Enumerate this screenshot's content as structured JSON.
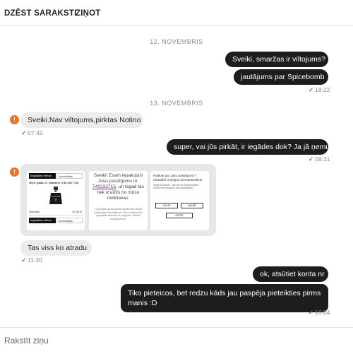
{
  "header": {
    "delete_label": "DZĒST SARAKSTI",
    "report_label": "ZIŅOT"
  },
  "dates": {
    "first": "12. NOVEMBRIS",
    "second": "13. NOVEMBRIS"
  },
  "messages": [
    {
      "text": "Sveiki, smaržas ir viltojums?"
    },
    {
      "text": "jautājums par Spicebomb",
      "time": "18:22"
    },
    {
      "text": "Sveiki.Nav viltojums,pirktas Notino",
      "time": "07:42"
    },
    {
      "text": "super, vai jūs pirkāt, ir iegādes dok? Ja jā ņemu",
      "time": "09:31"
    },
    {
      "text": "Tas viss ko atradu",
      "time": "11:30"
    },
    {
      "text": "ok, atsūtiet konta nr"
    },
    {
      "text": "Tiko pieteicos, bet redzu kāds jau paspēja pieteikties pirms manis :D",
      "time": "16:04"
    }
  ],
  "attachment": {
    "shot1": {
      "tab_a": "Iegādātas vērtas",
      "tab_b": "Informācija",
      "order_line": "2023. gada 27. oktobris (740 232 715)",
      "product_label": "kosmēts",
      "price": "67,62 €"
    },
    "shot2": {
      "message": "Sveiki! Esam iepakojuši Jūsu pasūtījumu nr. 740232715, un tagad tas tiek izsūtīts no mūsu noliktavas.",
      "order_number": "740232715",
      "small_text": "Turpinājās darba dienās vairāki tiem tiekot kurjerpasta līdzsūtījuma. Jūsu kotlatiņā tiks piegādāts saskaņā ar piegādes izvēlēto nosacījumiem."
    },
    "shot3": {
      "title": "Patīkas par Jūsu pasūtījumu? Ubaudiet manīgus Ziemassvētkus.",
      "body": "Sveiki apmekās. Vēlu šie šie vietnamokām izvēlnu liaz prieguās Jūsu pasūtījumu.",
      "button_a": "LEKSĪ",
      "button_b": "VAKNĪT",
      "button_c": "ATSŪT"
    }
  },
  "composer": {
    "placeholder": "Rakstīt ziņu"
  },
  "colors": {
    "accent": "#e8752a",
    "outgoing": "#1d1d1d",
    "incoming": "#ececec",
    "tick": "#2e9f5a"
  }
}
